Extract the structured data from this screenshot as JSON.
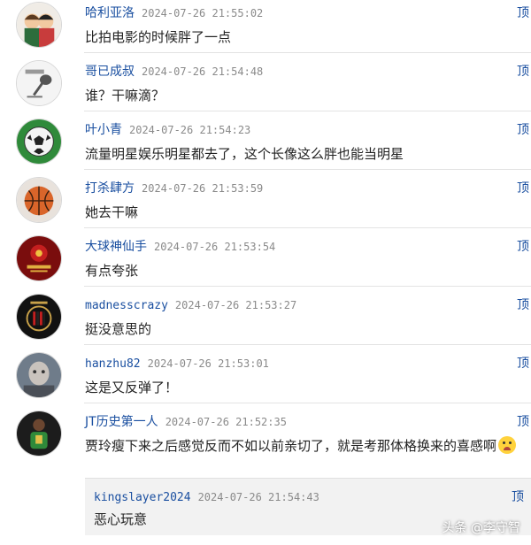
{
  "comments": [
    {
      "username": "哈利亚洛",
      "time": "2024-07-26 21:55:02",
      "text": "比拍电影的时候胖了一点",
      "top_label": "顶",
      "avatar": "cartoon-couple-avatar"
    },
    {
      "username": "哥已成叔",
      "time": "2024-07-26 21:54:48",
      "text": "谁？干嘛滴？",
      "top_label": "顶",
      "avatar": "microphone-avatar"
    },
    {
      "username": "叶小青",
      "time": "2024-07-26 21:54:23",
      "text": "流量明星娱乐明星都去了，这个长像这么胖也能当明星",
      "top_label": "顶",
      "avatar": "soccer-ball-avatar"
    },
    {
      "username": "打杀肆方",
      "time": "2024-07-26 21:53:59",
      "text": "她去干嘛",
      "top_label": "顶",
      "avatar": "basketball-avatar"
    },
    {
      "username": "大球神仙手",
      "time": "2024-07-26 21:53:54",
      "text": "有点夸张",
      "top_label": "顶",
      "avatar": "red-badge-avatar"
    },
    {
      "username": "madnesscrazy",
      "time": "2024-07-26 21:53:27",
      "text": "挺没意思的",
      "top_label": "顶",
      "avatar": "ac-milan-avatar"
    },
    {
      "username": "hanzhu82",
      "time": "2024-07-26 21:53:01",
      "text": "这是又反弹了！",
      "top_label": "顶",
      "avatar": "portrait-avatar"
    },
    {
      "username": "JT历史第一人",
      "time": "2024-07-26 21:52:35",
      "text": "贾玲瘦下来之后感觉反而不如以前亲切了，就是考那体格换来的喜感啊",
      "top_label": "顶",
      "avatar": "player-photo-avatar"
    }
  ],
  "reply": {
    "username": "kingslayer2024",
    "time": "2024-07-26 21:54:43",
    "text": "恶心玩意",
    "top_label": "顶"
  },
  "watermark": "头条 @李守智",
  "colors": {
    "username": "#1a4fa0",
    "timestamp": "#8a8a8a",
    "reply_bg": "#f2f2f2"
  }
}
